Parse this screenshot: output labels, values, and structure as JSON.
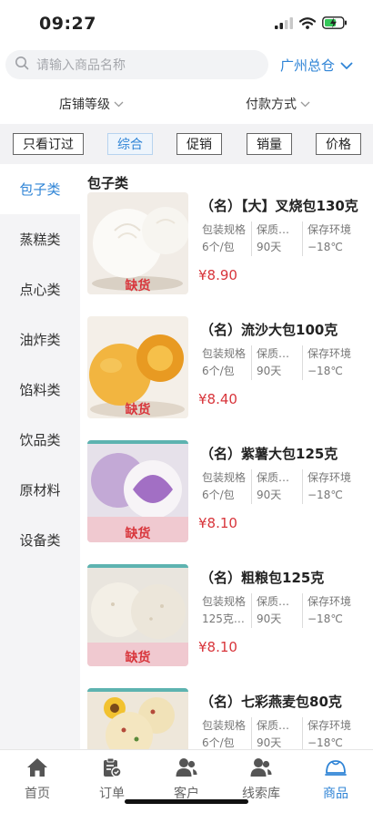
{
  "status": {
    "time": "09:27"
  },
  "search": {
    "placeholder": "请输入商品名称"
  },
  "warehouse": {
    "label": "广州总仓"
  },
  "filters": [
    {
      "label": "店铺等级"
    },
    {
      "label": "付款方式"
    }
  ],
  "sort": {
    "only_ordered": "只看订过",
    "options": [
      {
        "label": "综合",
        "active": true
      },
      {
        "label": "促销"
      },
      {
        "label": "销量"
      },
      {
        "label": "价格"
      }
    ]
  },
  "sidebar": {
    "items": [
      {
        "label": "包子类",
        "active": true
      },
      {
        "label": "蒸糕类"
      },
      {
        "label": "点心类"
      },
      {
        "label": "油炸类"
      },
      {
        "label": "馅料类"
      },
      {
        "label": "饮品类"
      },
      {
        "label": "原材料"
      },
      {
        "label": "设备类"
      }
    ]
  },
  "section": {
    "title": "包子类"
  },
  "spec_labels": {
    "packaging": "包装规格",
    "shelf_life": "保质…",
    "storage": "保存环境"
  },
  "products": [
    {
      "name": "（名）【大】叉烧包130克",
      "packaging": "6个/包",
      "shelf_life": "90天",
      "storage": "−18℃",
      "price": "¥8.90",
      "status": "缺货"
    },
    {
      "name": "（名）流沙大包100克",
      "packaging": "6个/包",
      "shelf_life": "90天",
      "storage": "−18℃",
      "price": "¥8.40",
      "status": "缺货"
    },
    {
      "name": "（名）紫薯大包125克",
      "packaging": "6个/包",
      "shelf_life": "90天",
      "storage": "−18℃",
      "price": "¥8.10",
      "status": "缺货"
    },
    {
      "name": "（名）粗粮包125克",
      "packaging": "125克…",
      "shelf_life": "90天",
      "storage": "−18℃",
      "price": "¥8.10",
      "status": "缺货"
    },
    {
      "name": "（名）七彩燕麦包80克",
      "packaging": "6个/包",
      "shelf_life": "90天",
      "storage": "−18℃",
      "price": "",
      "status": ""
    }
  ],
  "tabs": [
    {
      "label": "首页",
      "icon": "home-icon"
    },
    {
      "label": "订单",
      "icon": "clipboard-check-icon"
    },
    {
      "label": "客户",
      "icon": "user-group-icon"
    },
    {
      "label": "线索库",
      "icon": "user-group-icon"
    },
    {
      "label": "商品",
      "icon": "bun-icon",
      "active": true
    }
  ],
  "colors": {
    "accent": "#2f84d6",
    "price": "#d8353b",
    "sidebar_bg": "#f4f4f6"
  }
}
